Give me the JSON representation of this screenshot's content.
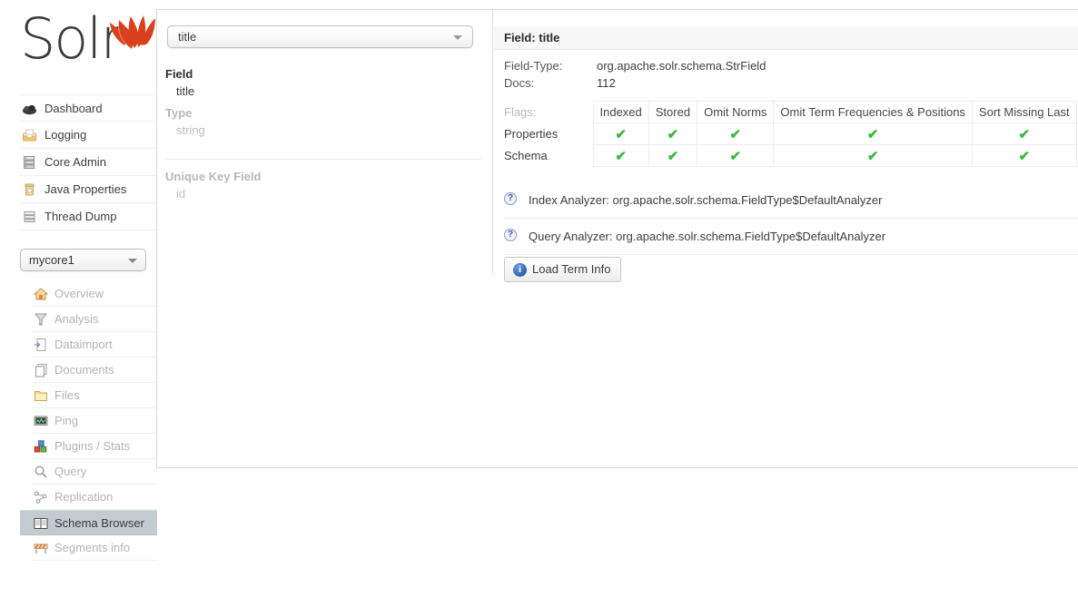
{
  "brand": {
    "name": "Solr",
    "logo_icon": "solr-flame-logo",
    "flame_color": "#d9411e"
  },
  "sidebar": {
    "main_items": [
      {
        "label": "Dashboard",
        "icon": "cloud-icon"
      },
      {
        "label": "Logging",
        "icon": "tray-icon"
      },
      {
        "label": "Core Admin",
        "icon": "servers-icon"
      },
      {
        "label": "Java Properties",
        "icon": "jar-icon"
      },
      {
        "label": "Thread Dump",
        "icon": "stack-icon"
      }
    ],
    "core_selector": {
      "value": "mycore1",
      "arrow_icon": "chevron-down-icon"
    },
    "sub_items": [
      {
        "label": "Overview",
        "icon": "home-icon",
        "active": false
      },
      {
        "label": "Analysis",
        "icon": "funnel-icon",
        "active": false
      },
      {
        "label": "Dataimport",
        "icon": "import-icon",
        "active": false
      },
      {
        "label": "Documents",
        "icon": "documents-icon",
        "active": false
      },
      {
        "label": "Files",
        "icon": "folder-icon",
        "active": false
      },
      {
        "label": "Ping",
        "icon": "monitor-icon",
        "active": false
      },
      {
        "label": "Plugins / Stats",
        "icon": "blocks-icon",
        "active": false
      },
      {
        "label": "Query",
        "icon": "magnifier-icon",
        "active": false
      },
      {
        "label": "Replication",
        "icon": "network-icon",
        "active": false
      },
      {
        "label": "Schema Browser",
        "icon": "open-book-icon",
        "active": true
      },
      {
        "label": "Segments info",
        "icon": "barrier-icon",
        "active": false
      }
    ],
    "active_background": "#c3cbd2"
  },
  "schema_browser": {
    "field_selector": {
      "value": "title",
      "arrow_icon": "chevron-down-icon"
    },
    "left_panel": {
      "field_heading": "Field",
      "field_value": "title",
      "type_heading": "Type",
      "type_value": "string",
      "unique_key_heading": "Unique Key Field",
      "unique_key_value": "id"
    },
    "detail": {
      "title": "Field: title",
      "field_type_label": "Field-Type:",
      "field_type_value": "org.apache.solr.schema.StrField",
      "docs_label": "Docs:",
      "docs_value": "112",
      "flags_label": "Flags:",
      "flags_columns": [
        "Indexed",
        "Stored",
        "Omit Norms",
        "Omit Term Frequencies & Positions",
        "Sort Missing Last"
      ],
      "flags_rows": [
        {
          "name": "Properties",
          "values": [
            true,
            true,
            true,
            true,
            true
          ]
        },
        {
          "name": "Schema",
          "values": [
            true,
            true,
            true,
            true,
            true
          ]
        }
      ],
      "check_glyph": "✔",
      "check_color": "#3eb83e",
      "analyzers": [
        {
          "help_icon": "question-circle-icon",
          "text": "Index Analyzer: org.apache.solr.schema.FieldType$DefaultAnalyzer"
        },
        {
          "help_icon": "question-circle-icon",
          "text": "Query Analyzer: org.apache.solr.schema.FieldType$DefaultAnalyzer"
        }
      ],
      "load_term_info_button": {
        "label": "Load Term Info",
        "icon": "info-circle-icon"
      }
    }
  }
}
